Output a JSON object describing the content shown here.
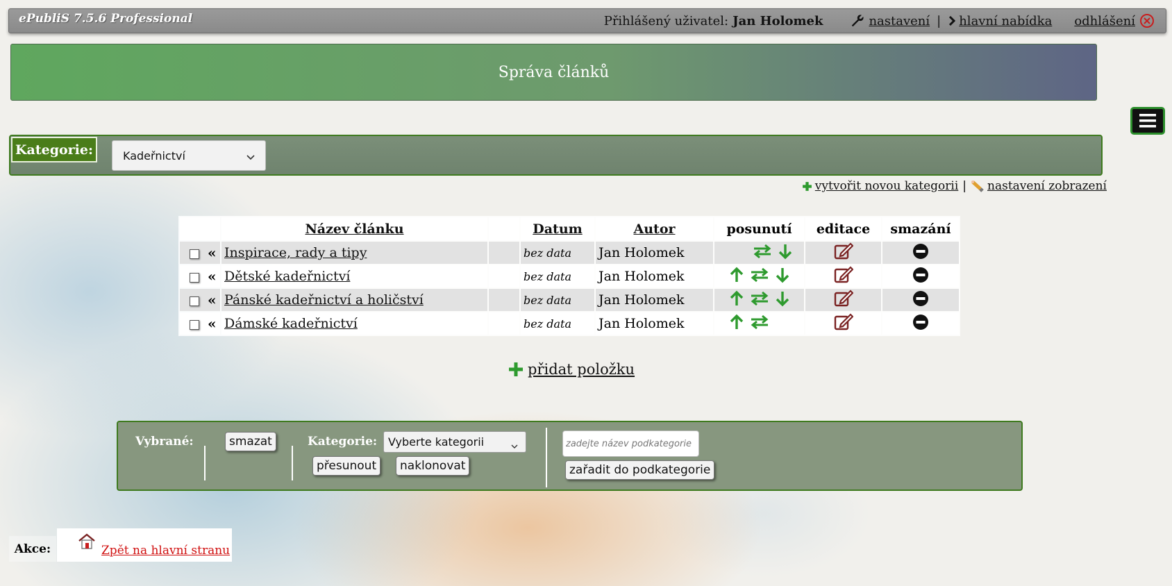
{
  "app": {
    "title": "ePubliS 7.5.6 Professional"
  },
  "user_bar": {
    "logged_label": "Přihlášený uživatel:",
    "user_name": "Jan Holomek",
    "settings": "nastavení",
    "separator": "|",
    "main_menu": "hlavní nabídka",
    "logout": "odhlášení"
  },
  "banner": {
    "title": "Správa článků"
  },
  "category": {
    "label": "Kategorie:",
    "selected": "Kadeřnictví"
  },
  "links": {
    "create_category": "vytvořit novou kategorii",
    "separator": "|",
    "display_settings": "nastavení zobrazení"
  },
  "table": {
    "headers": {
      "name": "Název článku",
      "date": "Datum",
      "author": "Autor",
      "move": "posunutí",
      "edit": "editace",
      "delete": "smazání"
    },
    "rows": [
      {
        "title": "Inspirace, rady a tipy",
        "date": "bez data",
        "author": "Jan Holomek"
      },
      {
        "title": "Dětské kadeřnictví",
        "date": "bez data",
        "author": "Jan Holomek"
      },
      {
        "title": "Pánské kadeřnictví a holičství",
        "date": "bez data",
        "author": "Jan Holomek"
      },
      {
        "title": "Dámské kadeřnictví",
        "date": "bez data",
        "author": "Jan Holomek"
      }
    ],
    "row_marker": "«"
  },
  "add_item": "přidat položku",
  "bulk": {
    "selected_label": "Vybrané:",
    "delete": "smazat",
    "category_label": "Kategorie:",
    "category_select": "Vyberte kategorii",
    "move": "přesunout",
    "clone": "naklonovat",
    "subcategory_placeholder": "zadejte název podkategorie",
    "assign_subcategory": "zařadit do podkategorie"
  },
  "actions": {
    "label": "Akce:",
    "home": "Zpět na hlavní stranu"
  },
  "colors": {
    "move_arrows": "#2e9a2e",
    "edit_icon": "#7a2222",
    "home_link": "#d01010",
    "green_border": "#3e7a1e"
  }
}
